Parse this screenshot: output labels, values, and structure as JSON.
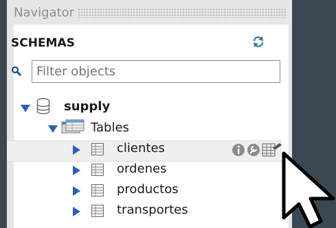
{
  "navigator": {
    "title": "Navigator"
  },
  "schemas_panel": {
    "heading": "SCHEMAS",
    "filter": {
      "placeholder": "Filter objects",
      "value": ""
    }
  },
  "tree": {
    "schema": {
      "name": "supply",
      "expanded": true
    },
    "tables_folder": {
      "label": "Tables",
      "expanded": true
    },
    "tables": [
      {
        "name": "clientes",
        "selected": true
      },
      {
        "name": "ordenes"
      },
      {
        "name": "productos"
      },
      {
        "name": "transportes"
      }
    ]
  },
  "icons": {
    "refresh": "refresh-icon",
    "search": "search-icon",
    "database": "database-icon",
    "folder": "tables-folder-icon",
    "table": "table-icon",
    "info": "info-icon",
    "wrench": "wrench-icon",
    "table_data": "table-data-icon",
    "cursor": "mouse-cursor"
  },
  "colors": {
    "background": "#3b4752",
    "panel": "#e6e6e6",
    "expand_arrow": "#2d5fb3",
    "selected_row": "#efefef"
  }
}
